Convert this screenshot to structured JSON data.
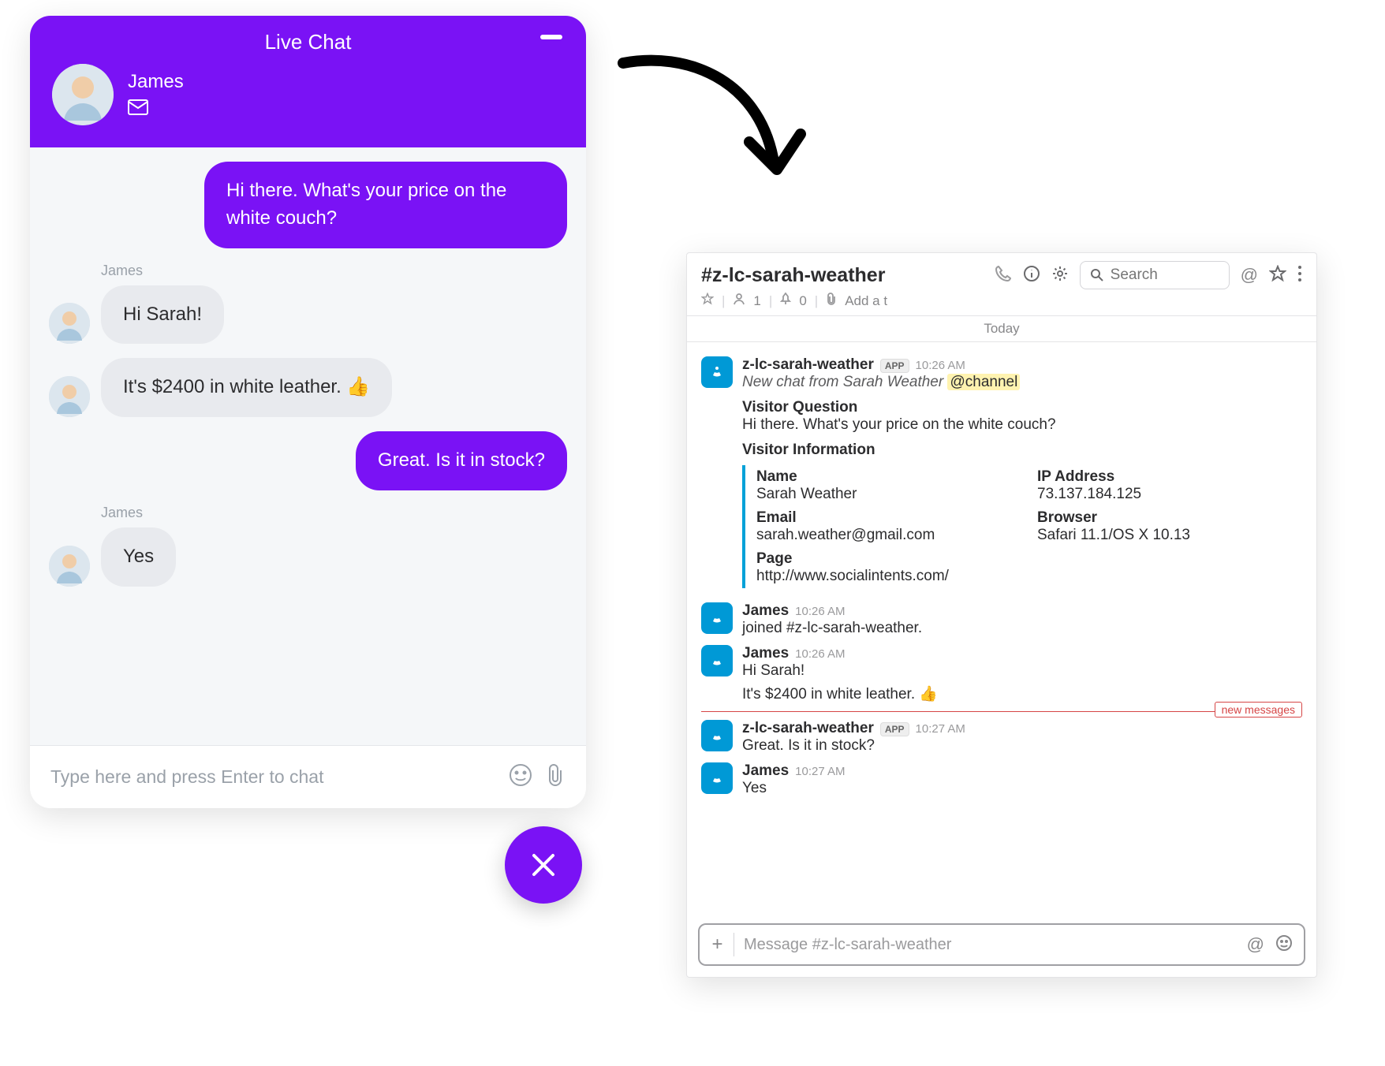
{
  "chat": {
    "title": "Live Chat",
    "agent_name": "James",
    "messages": [
      {
        "side": "out",
        "text": "Hi there. What's your price on the white couch?"
      },
      {
        "side": "in",
        "sender": "James",
        "text": "Hi Sarah!"
      },
      {
        "side": "in",
        "sender": "",
        "text": "It's $2400 in white leather. 👍"
      },
      {
        "side": "out",
        "text": "Great. Is it in stock?"
      },
      {
        "side": "in",
        "sender": "James",
        "text": "Yes"
      }
    ],
    "input_placeholder": "Type here and press Enter to chat"
  },
  "slack": {
    "channel": "#z-lc-sarah-weather",
    "meta": {
      "members": "1",
      "pins": "0",
      "add_topic": "Add a t"
    },
    "search_placeholder": "Search",
    "today_label": "Today",
    "entries": [
      {
        "type": "app_intro",
        "author": "z-lc-sarah-weather",
        "badge": "APP",
        "time": "10:26 AM",
        "intro_prefix": "New chat from Sarah Weather",
        "intro_highlight": "@channel",
        "question_heading": "Visitor Question",
        "question_text": "Hi there.  What's your price on the white couch?",
        "info_heading": "Visitor Information",
        "info": {
          "name_label": "Name",
          "name_value": "Sarah Weather",
          "ip_label": "IP Address",
          "ip_value": "73.137.184.125",
          "email_label": "Email",
          "email_value": "sarah.weather@gmail.com",
          "browser_label": "Browser",
          "browser_value": "Safari 11.1/OS X 10.13",
          "page_label": "Page",
          "page_value": "http://www.socialintents.com/"
        }
      },
      {
        "type": "join",
        "author": "James",
        "time": "10:26 AM",
        "text": "joined #z-lc-sarah-weather."
      },
      {
        "type": "msg",
        "author": "James",
        "time": "10:26 AM",
        "text": "Hi Sarah!",
        "extra": "It's $2400 in white leather. 👍"
      },
      {
        "type": "sep",
        "label": "new messages"
      },
      {
        "type": "msg",
        "author": "z-lc-sarah-weather",
        "badge": "APP",
        "time": "10:27 AM",
        "text": "Great.  Is it in stock?"
      },
      {
        "type": "msg",
        "author": "James",
        "time": "10:27 AM",
        "text": "Yes"
      }
    ],
    "compose_placeholder": "Message #z-lc-sarah-weather"
  }
}
